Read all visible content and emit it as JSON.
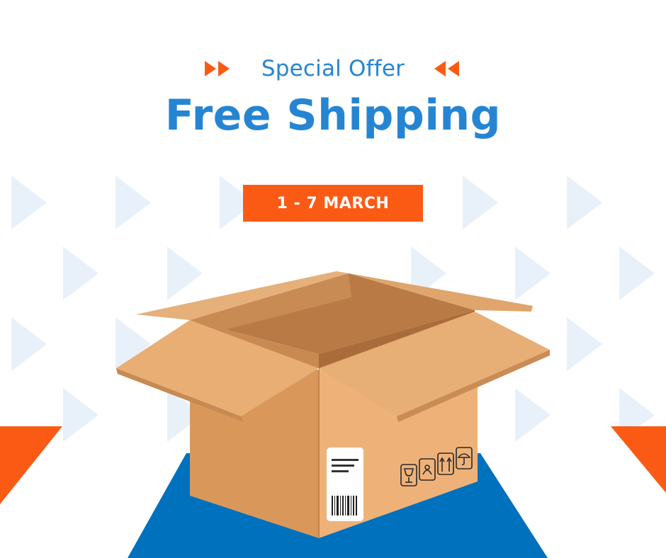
{
  "promo": {
    "subtitle": "Special Offer",
    "title": "Free Shipping",
    "dates": "1 - 7 MARCH"
  },
  "colors": {
    "brand_blue": "#2585d3",
    "accent_orange": "#fb5a15",
    "floor_blue": "#0071bc",
    "pattern_light": "#e8f1f9",
    "cardboard": "#e0a56c"
  },
  "icons": {
    "left_arrows": "double-chevron-right-icon",
    "right_arrows": "double-chevron-left-icon",
    "package": "cardboard-box-illustration",
    "handling_symbols": [
      "fragile-glass-icon",
      "handle-with-care-icon",
      "this-way-up-icon",
      "keep-dry-umbrella-icon"
    ]
  }
}
